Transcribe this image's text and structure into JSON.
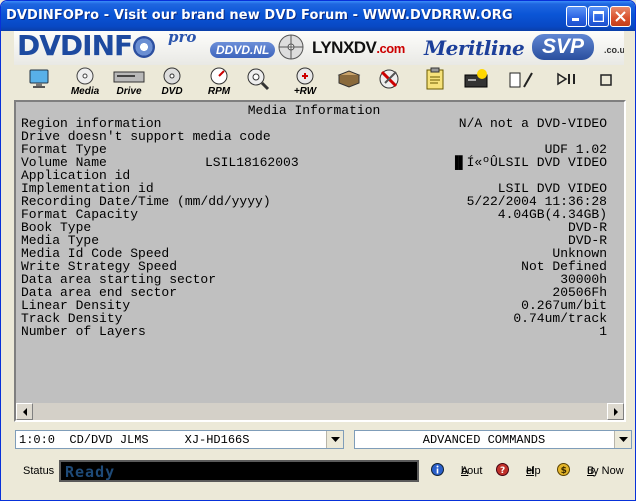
{
  "window": {
    "title": "DVDINFOPro  -  Visit our brand new DVD Forum  -  WWW.DVDRRW.ORG"
  },
  "banner": {
    "logo_text": "DVDINF",
    "logo_pro": "pro",
    "ddvd_label": "DDVD.NL",
    "lynx_label": "LYNXDV",
    "lynx_com": ".com",
    "meritline_label": "Meritline",
    "svp_label": "SVP",
    "svp_suffix": ".co.uk"
  },
  "toolbar": {
    "media_label": "Media",
    "drive_label": "Drive",
    "dvd_label": "DVD",
    "rpm_label": "RPM",
    "rw_label": "+RW"
  },
  "media_info": {
    "heading": "Media Information",
    "rows": [
      {
        "key": "Region information",
        "mid": "",
        "value": "N/A not a DVD-VIDEO"
      },
      {
        "key": "Drive doesn't support media code",
        "mid": "",
        "value": ""
      },
      {
        "key": "Format Type",
        "mid": "",
        "value": "UDF 1.02"
      },
      {
        "key": "Volume Name",
        "mid": "LSIL18162003",
        "value": "▐▌Í«ºÛLSIL DVD VIDEO"
      },
      {
        "key": "Application id",
        "mid": "",
        "value": ""
      },
      {
        "key": "Implementation id",
        "mid": "",
        "value": "LSIL DVD VIDEO"
      },
      {
        "key": "Recording Date/Time (mm/dd/yyyy)",
        "mid": "",
        "value": "5/22/2004 11:36:28"
      },
      {
        "key": "Format Capacity",
        "mid": "",
        "value": "4.04GB(4.34GB)"
      },
      {
        "key": "Book Type",
        "mid": "",
        "value": "DVD-R"
      },
      {
        "key": "Media Type",
        "mid": "",
        "value": "DVD-R"
      },
      {
        "key": "Media Id Code Speed",
        "mid": "",
        "value": "Unknown"
      },
      {
        "key": "Write Strategy Speed",
        "mid": "",
        "value": "Not Defined"
      },
      {
        "key": "Data area starting sector",
        "mid": "",
        "value": "30000h"
      },
      {
        "key": "Data area end sector",
        "mid": "",
        "value": "20506Fh"
      },
      {
        "key": "Linear Density",
        "mid": "",
        "value": "0.267um/bit"
      },
      {
        "key": "Track Density",
        "mid": "",
        "value": "0.74um/track"
      },
      {
        "key": "Number of Layers",
        "mid": "",
        "value": "1"
      }
    ]
  },
  "drive_select": {
    "value": "1:0:0  CD/DVD JLMS     XJ-HD166S"
  },
  "command_select": {
    "value": "ADVANCED COMMANDS"
  },
  "status": {
    "label": "Status",
    "text": "Ready"
  },
  "links": {
    "about_u": "A",
    "about_rest": "bout",
    "help_u": "H",
    "help_rest": "elp",
    "buy_u": "B",
    "buy_rest": "uy Now"
  },
  "colors": {
    "title_blue": "#0a55d6",
    "panel_gray": "#c0c0c0",
    "status_text": "#1e4a78"
  }
}
